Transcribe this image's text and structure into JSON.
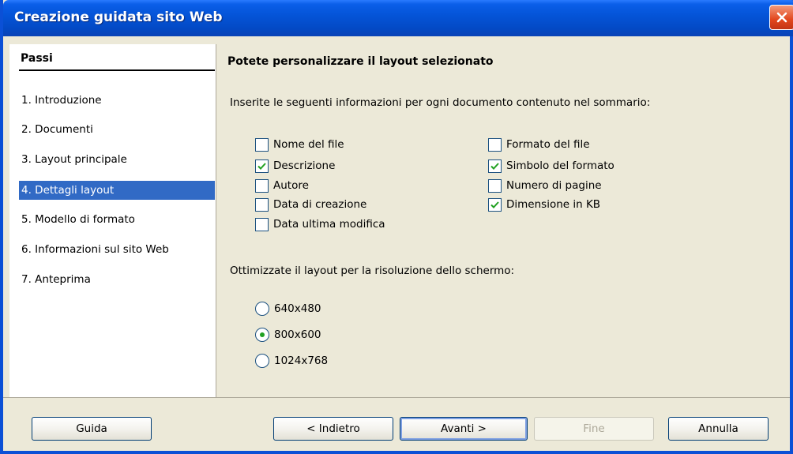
{
  "window": {
    "title": "Creazione guidata sito Web"
  },
  "steps": {
    "title": "Passi",
    "items": [
      {
        "label": "1. Introduzione"
      },
      {
        "label": "2. Documenti"
      },
      {
        "label": "3. Layout principale"
      },
      {
        "label": "4. Dettagli layout",
        "selected": true
      },
      {
        "label": "5. Modello di formato"
      },
      {
        "label": "6. Informazioni sul sito Web"
      },
      {
        "label": "7. Anteprima"
      }
    ]
  },
  "main": {
    "heading": "Potete personalizzare il layout selezionato",
    "intro": "Inserite le seguenti informazioni per ogni documento contenuto nel sommario:",
    "options_left": [
      {
        "label": "Nome del file",
        "checked": false
      },
      {
        "label": "Descrizione",
        "checked": true
      },
      {
        "label": "Autore",
        "checked": false
      },
      {
        "label": "Data di creazione",
        "checked": false
      },
      {
        "label": "Data ultima modifica",
        "checked": false
      }
    ],
    "options_right": [
      {
        "label": "Formato del file",
        "checked": false
      },
      {
        "label": "Simbolo del formato",
        "checked": true
      },
      {
        "label": "Numero di pagine",
        "checked": false
      },
      {
        "label": "Dimensione in KB",
        "checked": true
      }
    ],
    "resolution_label": "Ottimizzate il layout per la risoluzione dello schermo:",
    "resolutions": [
      {
        "label": "640x480",
        "selected": false
      },
      {
        "label": "800x600",
        "selected": true
      },
      {
        "label": "1024x768",
        "selected": false
      }
    ]
  },
  "buttons": {
    "help": "Guida",
    "back": "< Indietro",
    "next": "Avanti >",
    "finish": "Fine",
    "cancel": "Annulla"
  },
  "colors": {
    "titlebar": "#0453d6",
    "selection": "#316ac5",
    "check": "#21a121"
  }
}
